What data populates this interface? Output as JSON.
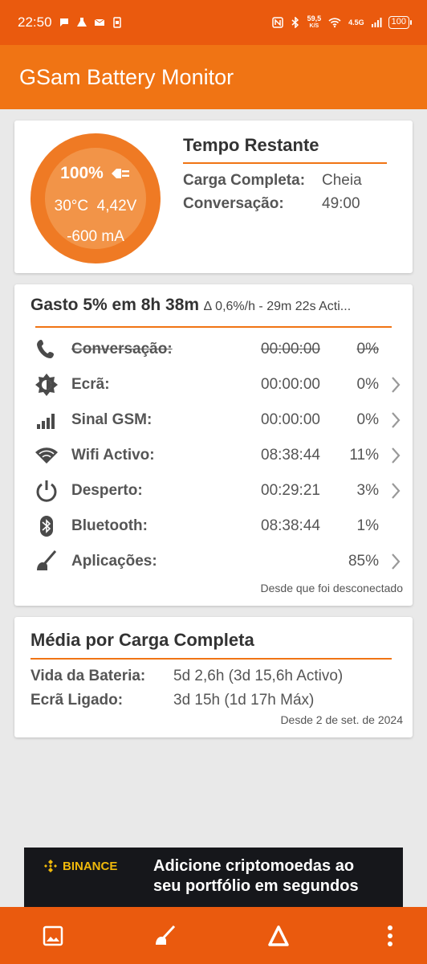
{
  "status_bar": {
    "time": "22:50",
    "net_speed": "59,5",
    "net_unit": "K/S",
    "network": "4.5G",
    "battery": "100"
  },
  "app": {
    "title": "GSam Battery Monitor"
  },
  "gauge": {
    "percent": "100%",
    "temperature": "30°C",
    "voltage": "4,42V",
    "current": "-600 mA",
    "plug_icon": "plug-icon"
  },
  "remaining": {
    "title": "Tempo Restante",
    "rows": [
      {
        "label": "Carga Completa:",
        "value": "Cheia"
      },
      {
        "label": "Conversação:",
        "value": "49:00"
      }
    ]
  },
  "usage": {
    "heading": "Gasto 5% em 8h 38m",
    "subheading": "∆ 0,6%/h - 29m 22s Acti...",
    "rows": [
      {
        "label": "Conversação:",
        "time": "00:00:00",
        "percent": "0%",
        "icon": "phone-icon",
        "disabled": true,
        "chevron": false
      },
      {
        "label": "Ecrã:",
        "time": "00:00:00",
        "percent": "0%",
        "icon": "brightness-icon",
        "disabled": false,
        "chevron": true
      },
      {
        "label": "Sinal GSM:",
        "time": "00:00:00",
        "percent": "0%",
        "icon": "signal-icon",
        "disabled": false,
        "chevron": true
      },
      {
        "label": "Wifi Activo:",
        "time": "08:38:44",
        "percent": "11%",
        "icon": "wifi-icon",
        "disabled": false,
        "chevron": true
      },
      {
        "label": "Desperto:",
        "time": "00:29:21",
        "percent": "3%",
        "icon": "power-icon",
        "disabled": false,
        "chevron": true
      },
      {
        "label": "Bluetooth:",
        "time": "08:38:44",
        "percent": "1%",
        "icon": "bluetooth-icon",
        "disabled": false,
        "chevron": false
      },
      {
        "label": "Aplicações:",
        "time": "",
        "percent": "85%",
        "icon": "apps-broom-icon",
        "disabled": false,
        "chevron": true
      }
    ],
    "footer": "Desde que foi desconectado"
  },
  "average": {
    "title": "Média por Carga Completa",
    "rows": [
      {
        "label": "Vida da Bateria:",
        "value": "5d 2,6h (3d 15,6h Activo)"
      },
      {
        "label": "Ecrã Ligado:",
        "value": "3d 15h (1d 17h Máx)"
      }
    ],
    "footer": "Desde 2 de set. de 2024"
  },
  "ad": {
    "brand": "BINANCE",
    "text_line1": "Adicione criptomoedas ao",
    "text_line2": "seu portfólio em segundos"
  },
  "bottom_nav": [
    "image-icon",
    "apps-broom-icon",
    "delta-icon",
    "more-vert-icon"
  ],
  "colors": {
    "status_bar": "#ea5a0e",
    "app_bar": "#f07414",
    "accent": "#f07414",
    "gauge_outer": "#ef7a24",
    "gauge_inner": "#f29448",
    "ad_bg": "#16171b",
    "ad_brand": "#f0b90b"
  }
}
